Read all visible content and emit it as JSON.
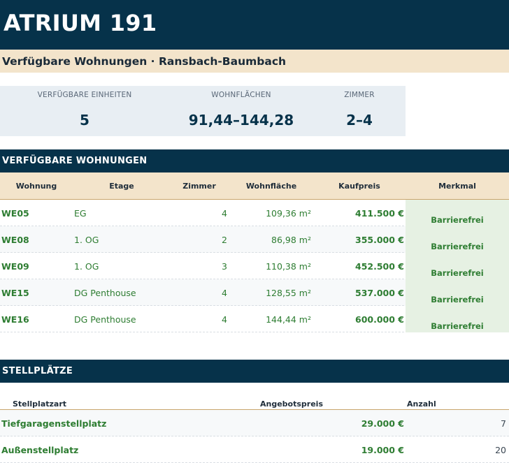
{
  "title": "ATRIUM 191",
  "subtitle": "Verfügbare Wohnungen · Ransbach-Baumbach",
  "stats": [
    {
      "label": "VERFÜGBARE EINHEITEN",
      "value": "5"
    },
    {
      "label": "WOHNFLÄCHEN",
      "value": "91,44–144,28"
    },
    {
      "label": "ZIMMER",
      "value": "2–4"
    }
  ],
  "apartments": {
    "heading": "VERFÜGBARE WOHNUNGEN",
    "columns": [
      "Wohnung",
      "Etage",
      "Zimmer",
      "Wohnfläche",
      "Kaufpreis",
      "Merkmal"
    ],
    "rows": [
      {
        "unit": "WE05",
        "floor": "EG",
        "rooms": "4",
        "area": "109,36 m²",
        "price": "411.500 €",
        "feature": "Barrierefrei"
      },
      {
        "unit": "WE08",
        "floor": "1. OG",
        "rooms": "2",
        "area": "86,98 m²",
        "price": "355.000 €",
        "feature": "Barrierefrei"
      },
      {
        "unit": "WE09",
        "floor": "1. OG",
        "rooms": "3",
        "area": "110,38 m²",
        "price": "452.500 €",
        "feature": "Barrierefrei"
      },
      {
        "unit": "WE15",
        "floor": "DG Penthouse",
        "rooms": "4",
        "area": "128,55 m²",
        "price": "537.000 €",
        "feature": "Barrierefrei"
      },
      {
        "unit": "WE16",
        "floor": "DG Penthouse",
        "rooms": "4",
        "area": "144,44 m²",
        "price": "600.000 €",
        "feature": "Barrierefrei"
      }
    ]
  },
  "parking": {
    "heading": "STELLPLÄTZE",
    "columns": [
      "Stellplatzart",
      "Angebotspreis",
      "Anzahl"
    ],
    "rows": [
      {
        "type": "Tiefgaragenstellplatz",
        "price": "29.000 €",
        "count": "7"
      },
      {
        "type": "Außenstellplatz",
        "price": "19.000 €",
        "count": "20"
      }
    ]
  },
  "colors": {
    "navy": "#06324a",
    "beige": "#f3e4cb",
    "green": "#2e7d32",
    "stat_bg": "#e8eef3",
    "feature_bg": "#e6f1e3"
  }
}
